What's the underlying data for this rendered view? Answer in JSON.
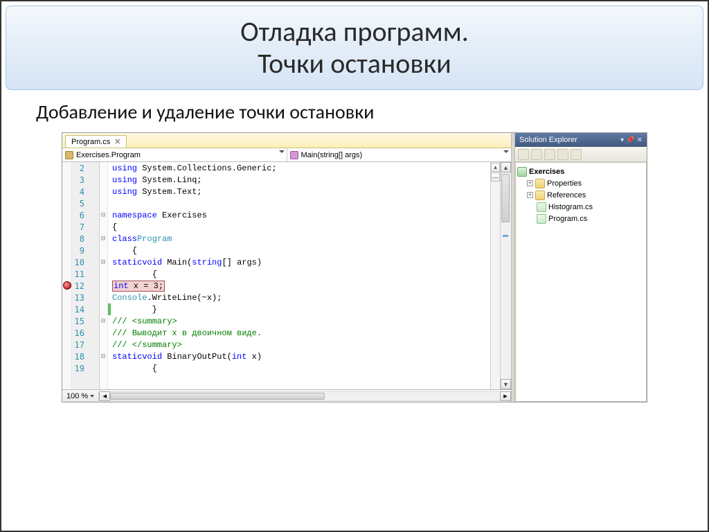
{
  "slide": {
    "title_line1": "Отладка программ.",
    "title_line2": "Точки остановки",
    "subtitle": "Добавление и удаление точки остановки"
  },
  "editor": {
    "tab_name": "Program.cs",
    "class_combo": "Exercises.Program",
    "method_combo": "Main(string[] args)",
    "zoom": "100 %",
    "lines": [
      {
        "n": 2,
        "toggle": "",
        "indent": 0,
        "html": "<span class='kw'>using</span> System.Collections.Generic;"
      },
      {
        "n": 3,
        "toggle": "",
        "indent": 0,
        "html": "<span class='kw'>using</span> System.Linq;"
      },
      {
        "n": 4,
        "toggle": "",
        "indent": 0,
        "html": "<span class='kw'>using</span> System.Text;"
      },
      {
        "n": 5,
        "toggle": "",
        "indent": 0,
        "html": ""
      },
      {
        "n": 6,
        "toggle": "⊟",
        "indent": 0,
        "html": "<span class='kw'>namespace</span> Exercises"
      },
      {
        "n": 7,
        "toggle": "",
        "indent": 0,
        "html": "{"
      },
      {
        "n": 8,
        "toggle": "⊟",
        "indent": 1,
        "html": "<span class='kw'>class</span> <span class='type'>Program</span>"
      },
      {
        "n": 9,
        "toggle": "",
        "indent": 1,
        "html": "{"
      },
      {
        "n": 10,
        "toggle": "⊟",
        "indent": 2,
        "html": "<span class='kw'>static</span> <span class='kw'>void</span> Main(<span class='kw'>string</span>[] args)"
      },
      {
        "n": 11,
        "toggle": "",
        "indent": 2,
        "html": "{"
      },
      {
        "n": 12,
        "toggle": "",
        "indent": 3,
        "html": "<span class='hl-breakpoint'><span class='kw'>int</span> x = 3;</span>",
        "breakpoint": true
      },
      {
        "n": 13,
        "toggle": "",
        "indent": 3,
        "html": "<span class='type'>Console</span>.WriteLine(~x);"
      },
      {
        "n": 14,
        "toggle": "",
        "indent": 2,
        "html": "}",
        "green": true
      },
      {
        "n": 15,
        "toggle": "⊟",
        "indent": 2,
        "html": "<span class='comment'>/// &lt;summary&gt;</span>"
      },
      {
        "n": 16,
        "toggle": "",
        "indent": 2,
        "html": "<span class='comment'>/// Выводит x в двоичном виде.</span>"
      },
      {
        "n": 17,
        "toggle": "",
        "indent": 2,
        "html": "<span class='comment'>/// &lt;/summary&gt;</span>"
      },
      {
        "n": 18,
        "toggle": "⊟",
        "indent": 2,
        "html": "<span class='kw'>static</span> <span class='kw'>void</span> BinaryOutPut(<span class='kw'>int</span> x)"
      },
      {
        "n": 19,
        "toggle": "",
        "indent": 2,
        "html": "{"
      }
    ]
  },
  "solution": {
    "title": "Solution Explorer",
    "project": "Exercises",
    "nodes": {
      "properties": "Properties",
      "references": "References",
      "file1": "Histogram.cs",
      "file2": "Program.cs"
    }
  }
}
